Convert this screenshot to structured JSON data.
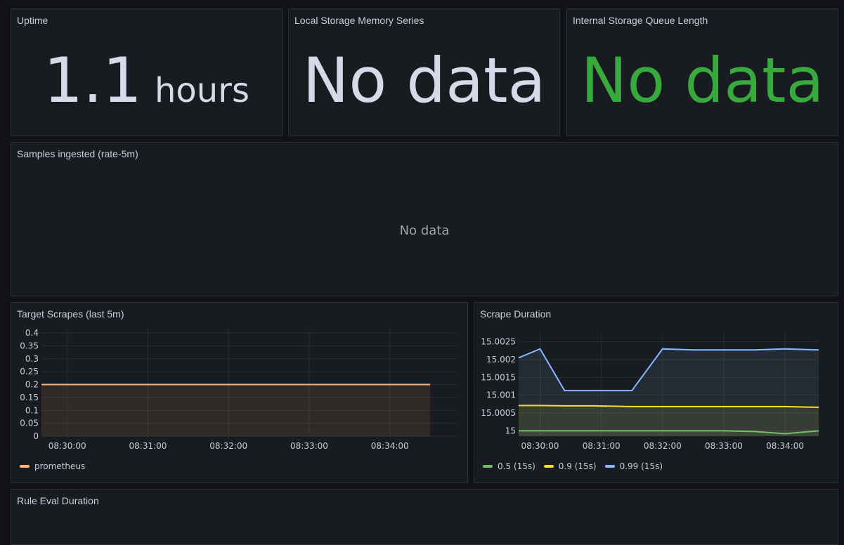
{
  "panels": {
    "uptime": {
      "title": "Uptime",
      "value": "1.1",
      "unit": "hours",
      "color": "#d8d9e8"
    },
    "local_storage": {
      "title": "Local Storage Memory Series",
      "value": "No data",
      "color": "#d8d9e8"
    },
    "internal_queue": {
      "title": "Internal Storage Queue Length",
      "value": "No data",
      "color": "#37a93d"
    },
    "samples": {
      "title": "Samples ingested (rate-5m)",
      "no_data": "No data"
    },
    "target_scrapes": {
      "title": "Target Scrapes (last 5m)",
      "legend": [
        {
          "name": "prometheus",
          "color": "#ffb577"
        }
      ]
    },
    "scrape_duration": {
      "title": "Scrape Duration",
      "legend": [
        {
          "name": "0.5 (15s)",
          "color": "#73bf69"
        },
        {
          "name": "0.9 (15s)",
          "color": "#fade2a"
        },
        {
          "name": "0.99 (15s)",
          "color": "#8ab8ff"
        }
      ]
    },
    "rule_eval": {
      "title": "Rule Eval Duration"
    }
  },
  "chart_data": [
    {
      "type": "line",
      "title": "Target Scrapes (last 5m)",
      "x_ticks": [
        "08:30:00",
        "08:31:00",
        "08:32:00",
        "08:33:00",
        "08:34:00"
      ],
      "y_ticks": [
        "0.4",
        "0.35",
        "0.3",
        "0.25",
        "0.2",
        "0.15",
        "0.1",
        "0.05",
        "0"
      ],
      "ylim": [
        0,
        0.4
      ],
      "xlim_min": [
        29.68,
        34.83
      ],
      "series": [
        {
          "name": "prometheus",
          "color": "#ffb577",
          "x_min": [
            29.68,
            34.5
          ],
          "values": [
            0.2,
            0.2
          ]
        }
      ]
    },
    {
      "type": "line",
      "title": "Scrape Duration",
      "x_ticks": [
        "08:30:00",
        "08:31:00",
        "08:32:00",
        "08:33:00",
        "08:34:00"
      ],
      "y_ticks": [
        "15.0025",
        "15.002",
        "15.0015",
        "15.001",
        "15.0005",
        "15"
      ],
      "ylim": [
        14.99985,
        15.00265
      ],
      "xlim_min": [
        29.65,
        34.55
      ],
      "series": [
        {
          "name": "0.5 (15s)",
          "color": "#73bf69",
          "x_min": [
            29.65,
            30.0,
            30.4,
            30.9,
            31.5,
            32.0,
            32.5,
            33.0,
            33.5,
            34.0,
            34.55
          ],
          "values": [
            15.0,
            15.0,
            15.0,
            15.0,
            15.0,
            15.0,
            15.0,
            15.0,
            14.99998,
            14.99992,
            15.0
          ]
        },
        {
          "name": "0.9 (15s)",
          "color": "#fade2a",
          "x_min": [
            29.65,
            30.0,
            30.4,
            30.9,
            31.5,
            32.0,
            32.5,
            33.0,
            33.5,
            34.0,
            34.55
          ],
          "values": [
            15.00071,
            15.00071,
            15.0007,
            15.0007,
            15.00068,
            15.00068,
            15.00068,
            15.00068,
            15.00068,
            15.00068,
            15.00066
          ]
        },
        {
          "name": "0.99 (15s)",
          "color": "#8ab8ff",
          "x_min": [
            29.65,
            30.0,
            30.4,
            30.9,
            31.5,
            32.0,
            32.5,
            33.0,
            33.5,
            34.0,
            34.55
          ],
          "values": [
            15.00205,
            15.0023,
            15.00113,
            15.00113,
            15.00113,
            15.0023,
            15.00227,
            15.00227,
            15.00227,
            15.0023,
            15.00227
          ]
        }
      ]
    }
  ]
}
